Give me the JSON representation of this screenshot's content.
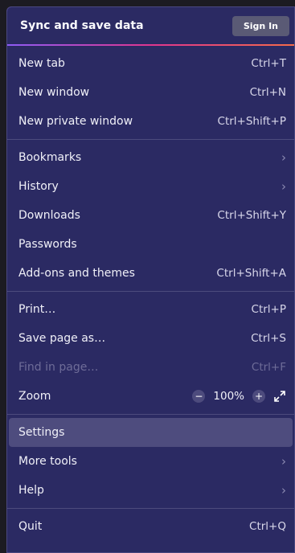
{
  "header": {
    "title": "Sync and save data",
    "sign_in": "Sign In"
  },
  "section1": [
    {
      "label": "New tab",
      "shortcut": "Ctrl+T"
    },
    {
      "label": "New window",
      "shortcut": "Ctrl+N"
    },
    {
      "label": "New private window",
      "shortcut": "Ctrl+Shift+P"
    }
  ],
  "section2": [
    {
      "label": "Bookmarks"
    },
    {
      "label": "History"
    },
    {
      "label": "Downloads",
      "shortcut": "Ctrl+Shift+Y"
    },
    {
      "label": "Passwords"
    },
    {
      "label": "Add-ons and themes",
      "shortcut": "Ctrl+Shift+A"
    }
  ],
  "section3": [
    {
      "label": "Print…",
      "shortcut": "Ctrl+P"
    },
    {
      "label": "Save page as…",
      "shortcut": "Ctrl+S"
    },
    {
      "label": "Find in page…",
      "shortcut": "Ctrl+F"
    }
  ],
  "zoom": {
    "label": "Zoom",
    "level": "100%",
    "minus": "−",
    "plus": "+"
  },
  "section4": [
    {
      "label": "Settings"
    },
    {
      "label": "More tools"
    },
    {
      "label": "Help"
    }
  ],
  "section5": [
    {
      "label": "Quit",
      "shortcut": "Ctrl+Q"
    }
  ],
  "icons": {
    "submenu": "chevron-right-icon",
    "fullscreen": "expand-arrows-icon"
  },
  "colors": {
    "menu_bg": "#2b2a63",
    "selected_bg": "#4e4c7e",
    "accent_gradient": [
      "#8e5cf6",
      "#e0368f",
      "#f66c4a"
    ]
  }
}
